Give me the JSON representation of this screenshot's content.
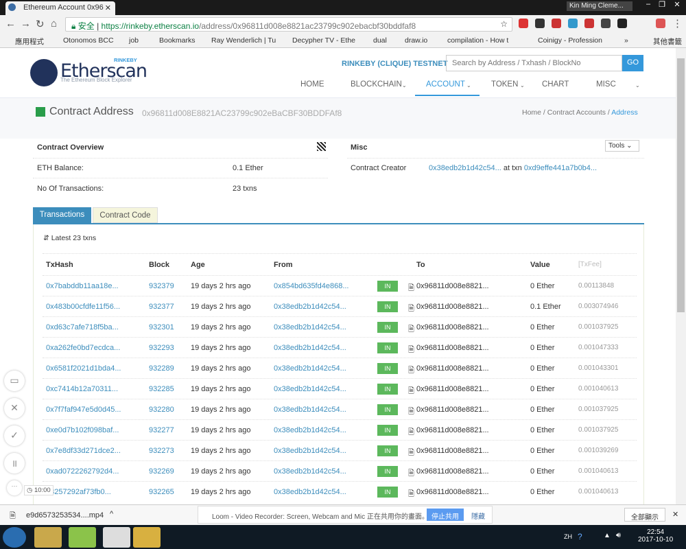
{
  "browser": {
    "tab_title": "Ethereum Account 0x96",
    "user": "Kin Ming Cleme...",
    "secure_label": "安全",
    "url_host": "https://rinkeby.etherscan.io",
    "url_path": "/address/0x96811d008e8821ac23799c902ebacbf30bddfaf8",
    "bookmarks": [
      "應用程式",
      "Otonomos BCC",
      "job",
      "Bookmarks",
      "Ray Wenderlich | Tu",
      "Decypher TV - Ethe",
      "dual",
      "draw.io",
      "compilation - How t",
      "Coinigy - Profession",
      "»",
      "其他書籤"
    ]
  },
  "site": {
    "logo": "Etherscan",
    "logo_sub": "The Ethereum Block Explorer",
    "logo_badge": "RINKEBY",
    "network": "RINKEBY (CLIQUE) TESTNET",
    "search_placeholder": "Search by Address / Txhash / BlockNo",
    "go": "GO",
    "nav": [
      "HOME",
      "BLOCKCHAIN",
      "ACCOUNT",
      "TOKEN",
      "CHART",
      "MISC"
    ]
  },
  "title": {
    "heading": "Contract Address",
    "address": "0x96811d008E8821AC23799c902eBaCBF30BDDFAf8",
    "breadcrumb": [
      "Home",
      "Contract Accounts",
      "Address"
    ]
  },
  "overview": {
    "title": "Contract Overview",
    "balance_label": "ETH Balance:",
    "balance": "0.1 Ether",
    "txcount_label": "No Of Transactions:",
    "txcount": "23 txns"
  },
  "misc": {
    "title": "Misc",
    "tools": "Tools",
    "creator_label": "Contract Creator",
    "creator": "0x38edb2b1d42c54...",
    "at_txn": "at txn",
    "txn": "0xd9effe441a7b0b4..."
  },
  "tabs": {
    "transactions": "Transactions",
    "code": "Contract Code"
  },
  "table": {
    "latest": "Latest 23 txns",
    "headers": [
      "TxHash",
      "Block",
      "Age",
      "From",
      "To",
      "Value",
      "[TxFee]"
    ],
    "rows": [
      [
        "0x7babddb11aa18e...",
        "932379",
        "19 days 2 hrs ago",
        "0x854bd635fd4e868...",
        "IN",
        "0x96811d008e8821...",
        "0 Ether",
        "0.00113848"
      ],
      [
        "0x483b00cfdfe11f56...",
        "932377",
        "19 days 2 hrs ago",
        "0x38edb2b1d42c54...",
        "IN",
        "0x96811d008e8821...",
        "0.1 Ether",
        "0.003074946"
      ],
      [
        "0xd63c7afe718f5ba...",
        "932301",
        "19 days 2 hrs ago",
        "0x38edb2b1d42c54...",
        "IN",
        "0x96811d008e8821...",
        "0 Ether",
        "0.001037925"
      ],
      [
        "0xa262fe0bd7ecdca...",
        "932293",
        "19 days 2 hrs ago",
        "0x38edb2b1d42c54...",
        "IN",
        "0x96811d008e8821...",
        "0 Ether",
        "0.001047333"
      ],
      [
        "0x6581f2021d1bda4...",
        "932289",
        "19 days 2 hrs ago",
        "0x38edb2b1d42c54...",
        "IN",
        "0x96811d008e8821...",
        "0 Ether",
        "0.001043301"
      ],
      [
        "0xc7414b12a70311...",
        "932285",
        "19 days 2 hrs ago",
        "0x38edb2b1d42c54...",
        "IN",
        "0x96811d008e8821...",
        "0 Ether",
        "0.001040613"
      ],
      [
        "0x7f7faf947e5d0d45...",
        "932280",
        "19 days 2 hrs ago",
        "0x38edb2b1d42c54...",
        "IN",
        "0x96811d008e8821...",
        "0 Ether",
        "0.001037925"
      ],
      [
        "0xe0d7b102f098baf...",
        "932277",
        "19 days 2 hrs ago",
        "0x38edb2b1d42c54...",
        "IN",
        "0x96811d008e8821...",
        "0 Ether",
        "0.001037925"
      ],
      [
        "0x7e8df33d271dce2...",
        "932273",
        "19 days 2 hrs ago",
        "0x38edb2b1d42c54...",
        "IN",
        "0x96811d008e8821...",
        "0 Ether",
        "0.001039269"
      ],
      [
        "0xad0722262792d4...",
        "932269",
        "19 days 2 hrs ago",
        "0x38edb2b1d42c54...",
        "IN",
        "0x96811d008e8821...",
        "0 Ether",
        "0.001040613"
      ],
      [
        "98257292af73fb0...",
        "932265",
        "19 days 2 hrs ago",
        "0x38edb2b1d42c54...",
        "IN",
        "0x96811d008e8821...",
        "0 Ether",
        "0.001040613"
      ]
    ]
  },
  "loom": {
    "timer": "10:00"
  },
  "downloads": {
    "file": "e9d6573253534....mp4",
    "share_msg": "Loom - Video Recorder: Screen, Webcam and Mic 正在共用你的畫面。",
    "stop": "停止共用",
    "hide": "隱藏",
    "show_all": "全部顯示"
  },
  "taskbar": {
    "lang": "ZH",
    "time": "22:54",
    "date": "2017-10-10"
  }
}
